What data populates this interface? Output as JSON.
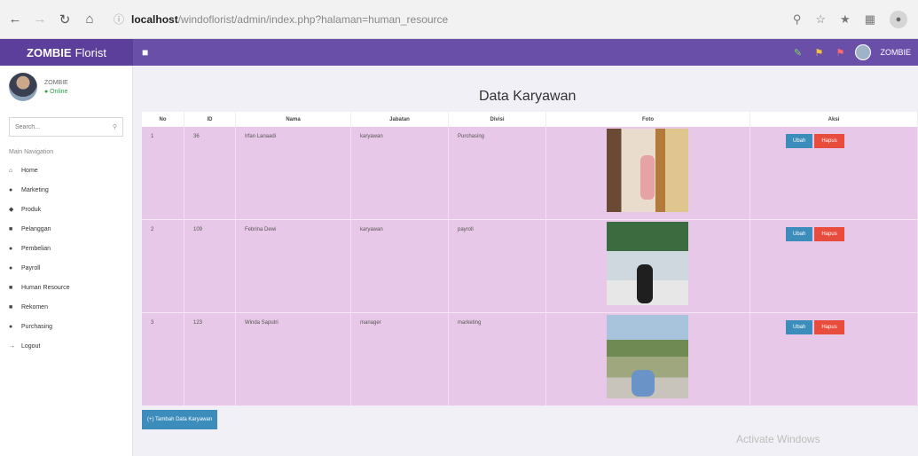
{
  "browser": {
    "url_host": "localhost",
    "url_path": "/windoflorist/admin/index.php?halaman=human_resource"
  },
  "app": {
    "brand_bold": "ZOMBIE",
    "brand_rest": "Florist",
    "header_user": "ZOMBIE"
  },
  "sidebar": {
    "user_name": "ZOMBIE",
    "user_status": "● Online",
    "search_placeholder": "Search...",
    "nav_header": "Main Navigation",
    "items": [
      {
        "label": "Home",
        "icon": "home-icon"
      },
      {
        "label": "Marketing",
        "icon": "pin-icon"
      },
      {
        "label": "Produk",
        "icon": "tag-icon"
      },
      {
        "label": "Pelanggan",
        "icon": "user-icon"
      },
      {
        "label": "Pembelian",
        "icon": "pin-icon"
      },
      {
        "label": "Payroll",
        "icon": "pin-icon"
      },
      {
        "label": "Human Resource",
        "icon": "user-icon"
      },
      {
        "label": "Rekomen",
        "icon": "user-icon"
      },
      {
        "label": "Purchasing",
        "icon": "pin-icon"
      },
      {
        "label": "Logout",
        "icon": "logout-icon"
      }
    ]
  },
  "main": {
    "title": "Data Karyawan",
    "columns": [
      "No",
      "ID",
      "Nama",
      "Jabatan",
      "Divisi",
      "Foto",
      "Aksi"
    ],
    "rows": [
      {
        "no": "1",
        "id": "36",
        "nama": "Irfan Lanaadi",
        "jabatan": "karyawan",
        "divisi": "Purchasing"
      },
      {
        "no": "2",
        "id": "109",
        "nama": "Febrina Dewi",
        "jabatan": "karyawan",
        "divisi": "payroll"
      },
      {
        "no": "3",
        "id": "123",
        "nama": "Winda Saputri",
        "jabatan": "manager",
        "divisi": "marketing"
      }
    ],
    "edit_label": "Ubah",
    "delete_label": "Hapus",
    "add_label": "(+) Tambah Data Karyawan"
  },
  "watermark": "Activate Windows"
}
